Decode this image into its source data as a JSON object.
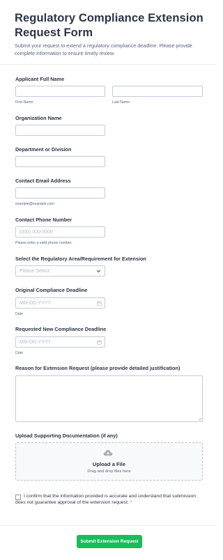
{
  "header": {
    "title": "Regulatory Compliance Extension Request Form",
    "subtitle": "Submit your request to extend a regulatory compliance deadline. Please provide complete information to ensure timely review."
  },
  "fields": {
    "applicant_name": {
      "label": "Applicant Full Name",
      "first_sublabel": "First Name",
      "last_sublabel": "Last Name",
      "first_value": "",
      "last_value": ""
    },
    "organization": {
      "label": "Organization Name",
      "value": ""
    },
    "department": {
      "label": "Department or Division",
      "value": ""
    },
    "email": {
      "label": "Contact Email Address",
      "value": "",
      "sublabel": "example@example.com"
    },
    "phone": {
      "label": "Contact Phone Number",
      "placeholder": "(000) 000-0000",
      "sublabel": "Please enter a valid phone number."
    },
    "regulatory_area": {
      "label": "Select the Regulatory Area/Requirement for Extension",
      "selected": "Please Select"
    },
    "original_deadline": {
      "label": "Original Compliance Deadline",
      "placeholder": "MM-DD-YYYY",
      "sublabel": "Date"
    },
    "new_deadline": {
      "label": "Requested New Compliance Deadline",
      "placeholder": "MM-DD-YYYY",
      "sublabel": "Date"
    },
    "reason": {
      "label": "Reason for Extension Request (please provide detailed justification)",
      "value": ""
    },
    "upload": {
      "label": "Upload Supporting Documentation (if any)",
      "title": "Upload a File",
      "hint": "Drag and drop files here"
    },
    "confirmation": {
      "text": "I confirm that the information provided is accurate and understand that submission does not guarantee approval of the extension request.",
      "required_mark": "*",
      "checked": false
    }
  },
  "submit": {
    "label": "Submit Extension Request"
  },
  "colors": {
    "accent": "#18bd5b",
    "required": "#f23a3c",
    "text": "#2c3345",
    "border": "#c3cad8"
  },
  "icons": [
    "cloud-upload-icon",
    "calendar-icon",
    "chevron-down-icon",
    "resize-handle-icon"
  ]
}
